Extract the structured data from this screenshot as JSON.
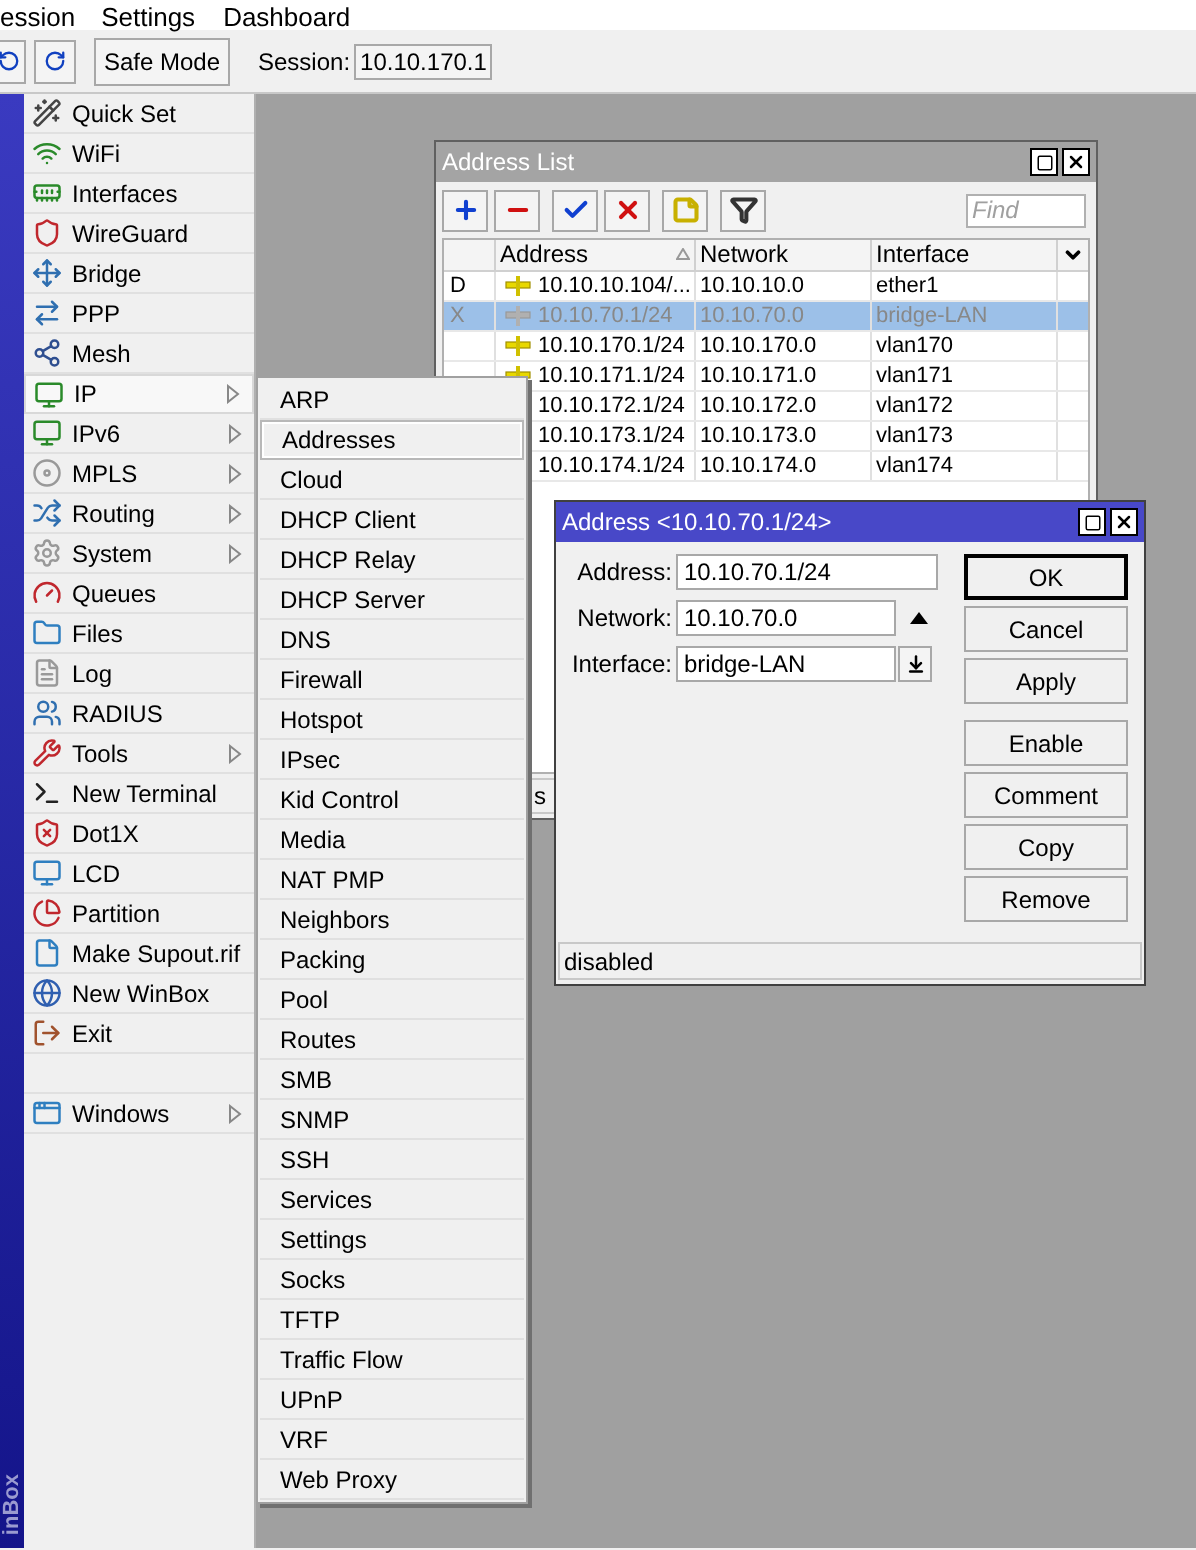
{
  "menubar": [
    {
      "label": "ession"
    },
    {
      "label": "Settings"
    },
    {
      "label": "Dashboard"
    }
  ],
  "toolbar": {
    "safe_mode": "Safe Mode",
    "session_label": "Session:",
    "session_value": "10.10.170.1"
  },
  "brand": "inBox",
  "sidebar": {
    "items": [
      {
        "label": "Quick Set",
        "submenu": false,
        "selected": false
      },
      {
        "label": "WiFi",
        "submenu": false,
        "selected": false
      },
      {
        "label": "Interfaces",
        "submenu": false,
        "selected": false
      },
      {
        "label": "WireGuard",
        "submenu": false,
        "selected": false
      },
      {
        "label": "Bridge",
        "submenu": false,
        "selected": false
      },
      {
        "label": "PPP",
        "submenu": false,
        "selected": false
      },
      {
        "label": "Mesh",
        "submenu": false,
        "selected": false
      },
      {
        "label": "IP",
        "submenu": true,
        "selected": true
      },
      {
        "label": "IPv6",
        "submenu": true,
        "selected": false
      },
      {
        "label": "MPLS",
        "submenu": true,
        "selected": false
      },
      {
        "label": "Routing",
        "submenu": true,
        "selected": false
      },
      {
        "label": "System",
        "submenu": true,
        "selected": false
      },
      {
        "label": "Queues",
        "submenu": false,
        "selected": false
      },
      {
        "label": "Files",
        "submenu": false,
        "selected": false
      },
      {
        "label": "Log",
        "submenu": false,
        "selected": false
      },
      {
        "label": "RADIUS",
        "submenu": false,
        "selected": false
      },
      {
        "label": "Tools",
        "submenu": true,
        "selected": false
      },
      {
        "label": "New Terminal",
        "submenu": false,
        "selected": false
      },
      {
        "label": "Dot1X",
        "submenu": false,
        "selected": false
      },
      {
        "label": "LCD",
        "submenu": false,
        "selected": false
      },
      {
        "label": "Partition",
        "submenu": false,
        "selected": false
      },
      {
        "label": "Make Supout.rif",
        "submenu": false,
        "selected": false
      },
      {
        "label": "New WinBox",
        "submenu": false,
        "selected": false
      },
      {
        "label": "Exit",
        "submenu": false,
        "selected": false
      }
    ],
    "bottom_items": [
      {
        "label": "Windows",
        "submenu": true,
        "selected": false
      }
    ]
  },
  "submenu": {
    "items": [
      {
        "label": "ARP",
        "selected": false
      },
      {
        "label": "Addresses",
        "selected": true
      },
      {
        "label": "Cloud",
        "selected": false
      },
      {
        "label": "DHCP Client",
        "selected": false
      },
      {
        "label": "DHCP Relay",
        "selected": false
      },
      {
        "label": "DHCP Server",
        "selected": false
      },
      {
        "label": "DNS",
        "selected": false
      },
      {
        "label": "Firewall",
        "selected": false
      },
      {
        "label": "Hotspot",
        "selected": false
      },
      {
        "label": "IPsec",
        "selected": false
      },
      {
        "label": "Kid Control",
        "selected": false
      },
      {
        "label": "Media",
        "selected": false
      },
      {
        "label": "NAT PMP",
        "selected": false
      },
      {
        "label": "Neighbors",
        "selected": false
      },
      {
        "label": "Packing",
        "selected": false
      },
      {
        "label": "Pool",
        "selected": false
      },
      {
        "label": "Routes",
        "selected": false
      },
      {
        "label": "SMB",
        "selected": false
      },
      {
        "label": "SNMP",
        "selected": false
      },
      {
        "label": "SSH",
        "selected": false
      },
      {
        "label": "Services",
        "selected": false
      },
      {
        "label": "Settings",
        "selected": false
      },
      {
        "label": "Socks",
        "selected": false
      },
      {
        "label": "TFTP",
        "selected": false
      },
      {
        "label": "Traffic Flow",
        "selected": false
      },
      {
        "label": "UPnP",
        "selected": false
      },
      {
        "label": "VRF",
        "selected": false
      },
      {
        "label": "Web Proxy",
        "selected": false
      }
    ]
  },
  "address_list": {
    "title": "Address List",
    "find_placeholder": "Find",
    "columns": [
      {
        "label": "Address",
        "sorted": true
      },
      {
        "label": "Network",
        "sorted": false
      },
      {
        "label": "Interface",
        "sorted": false
      }
    ],
    "rows": [
      {
        "flag": "D",
        "address": "10.10.10.104/...",
        "network": "10.10.10.0",
        "interface": "ether1",
        "disabled": false,
        "selected": false
      },
      {
        "flag": "X",
        "address": "10.10.70.1/24",
        "network": "10.10.70.0",
        "interface": "bridge-LAN",
        "disabled": true,
        "selected": true
      },
      {
        "address": "10.10.170.1/24",
        "network": "10.10.170.0",
        "interface": "vlan170",
        "disabled": false,
        "selected": false
      },
      {
        "address": "10.10.171.1/24",
        "network": "10.10.171.0",
        "interface": "vlan171",
        "disabled": false,
        "selected": false
      },
      {
        "address": "10.10.172.1/24",
        "network": "10.10.172.0",
        "interface": "vlan172",
        "disabled": false,
        "selected": false
      },
      {
        "address": "10.10.173.1/24",
        "network": "10.10.173.0",
        "interface": "vlan173",
        "disabled": false,
        "selected": false
      },
      {
        "address": "10.10.174.1/24",
        "network": "10.10.174.0",
        "interface": "vlan174",
        "disabled": false,
        "selected": false
      }
    ],
    "status": "s"
  },
  "dialog": {
    "title": "Address <10.10.70.1/24>",
    "fields": [
      {
        "label": "Address:",
        "value": "10.10.70.1/24",
        "kind": "text"
      },
      {
        "label": "Network:",
        "value": "10.10.70.0",
        "kind": "spin"
      },
      {
        "label": "Interface:",
        "value": "bridge-LAN",
        "kind": "select"
      }
    ],
    "buttons": [
      {
        "label": "OK",
        "default": true
      },
      {
        "label": "Cancel",
        "default": false
      },
      {
        "label": "Apply",
        "default": false
      }
    ],
    "action_buttons": [
      {
        "label": "Enable"
      },
      {
        "label": "Comment"
      },
      {
        "label": "Copy"
      },
      {
        "label": "Remove"
      }
    ],
    "status": "disabled"
  }
}
